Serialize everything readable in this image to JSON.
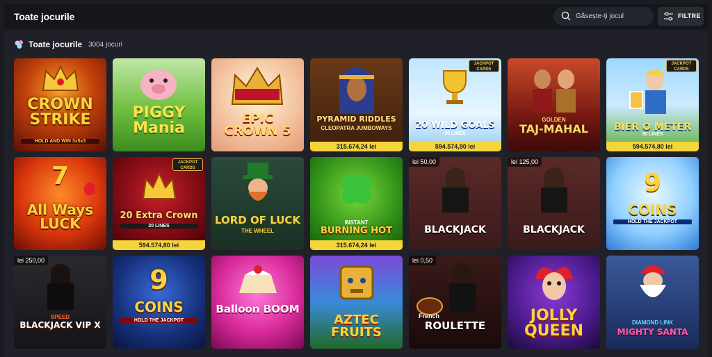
{
  "header": {
    "title": "Toate jocurile",
    "search_placeholder": "Găsește-ți jocul",
    "filter_label": "FILTRE"
  },
  "section": {
    "title": "Toate jocurile",
    "count": "3004 jocuri"
  },
  "games": [
    {
      "title": "CROWN STRIKE",
      "subtitle": "HOLD AND WIN 3x5x3"
    },
    {
      "title": "PIGGY Mania"
    },
    {
      "title": "EPIC CROWN 5"
    },
    {
      "title": "PYRAMID RIDDLES",
      "subtitle": "CLEOPATRA JUMBOWAYS",
      "jackpot": "315.674,24 lei"
    },
    {
      "title": "20 WILD GOALS",
      "subtitle": "20 LINES",
      "jackpot": "594.574,80 lei",
      "badge": "JACKPOT CARDS"
    },
    {
      "title": "TAJ-MAHAL",
      "subtitle": "GOLDEN"
    },
    {
      "title": "BIER O METER",
      "subtitle": "30 LINES",
      "jackpot": "594.574,80 lei",
      "badge": "JACKPOT CARDS"
    },
    {
      "title": "All Ways LUCK"
    },
    {
      "title": "20 Extra Crown",
      "subtitle": "20 LINES",
      "jackpot": "594.574,80 lei",
      "badge": "JACKPOT CARDS"
    },
    {
      "title": "LORD OF LUCK",
      "subtitle": "THE WHEEL"
    },
    {
      "title": "BURNING HOT",
      "subtitle": "INSTANT",
      "jackpot": "315.674,24 lei"
    },
    {
      "title": "BLACKJACK",
      "bet": "lei 50,00"
    },
    {
      "title": "BLACKJACK",
      "bet": "lei 125,00"
    },
    {
      "title": "COINS",
      "subtitle": "HOLD THE JACKPOT"
    },
    {
      "title": "BLACKJACK VIP X",
      "subtitle": "SPEED",
      "bet": "lei 250,00"
    },
    {
      "title": "COINS",
      "subtitle": "HOLD THE JACKPOT"
    },
    {
      "title": "Balloon BOOM"
    },
    {
      "title": "AZTEC FRUITS"
    },
    {
      "title": "ROULETTE",
      "subtitle": "French",
      "bet": "lei 0,50"
    },
    {
      "title": "JOLLY QUEEN"
    },
    {
      "title": "MIGHTY SANTA",
      "subtitle": "DIAMOND LINK"
    }
  ],
  "colors": {
    "jackpot_bar": "#f5d53a",
    "background": "#1b1c22"
  }
}
